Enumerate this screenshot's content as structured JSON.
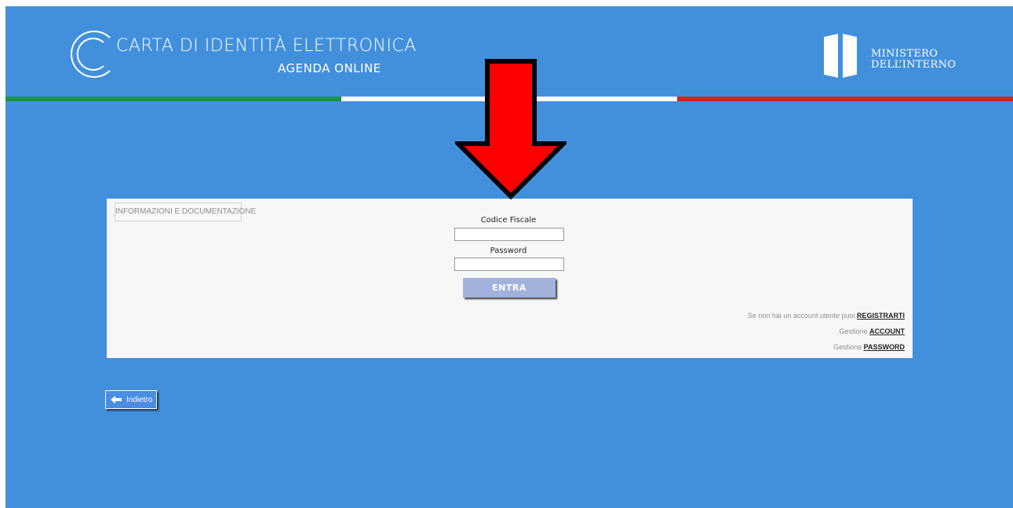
{
  "header": {
    "title": "CARTA DI IDENTITÀ ELETTRONICA",
    "subtitle": "AGENDA ONLINE",
    "ministry_line1": "MINISTERO",
    "ministry_line2": "DELL’INTERNO",
    "logo_icon": "cie-logo-icon",
    "ministry_icon": "ministry-logo-icon"
  },
  "flag_colors": {
    "green": "#199448",
    "white": "#ffffff",
    "red": "#d5241d"
  },
  "colors": {
    "background": "#4290dc",
    "panel": "#f7f7f7",
    "entra_button": "#a3b2dd",
    "arrow": "#ff0000"
  },
  "annotation": {
    "icon": "red-arrow-down-icon"
  },
  "login": {
    "info_button": "INFORMAZIONI E DOCUMENTAZIONE",
    "codice_fiscale_label": "Codice Fiscale",
    "codice_fiscale_value": "",
    "password_label": "Password",
    "password_value": "",
    "submit_label": "ENTRA",
    "register_prefix": "Se non hai un account utente puoi ",
    "register_link": "REGISTRARTI",
    "account_prefix": "Gestione ",
    "account_link": "ACCOUNT",
    "password_prefix": "Gestione ",
    "password_link": "PASSWORD"
  },
  "back": {
    "label": "Indietro",
    "icon": "back-arrow-icon"
  }
}
